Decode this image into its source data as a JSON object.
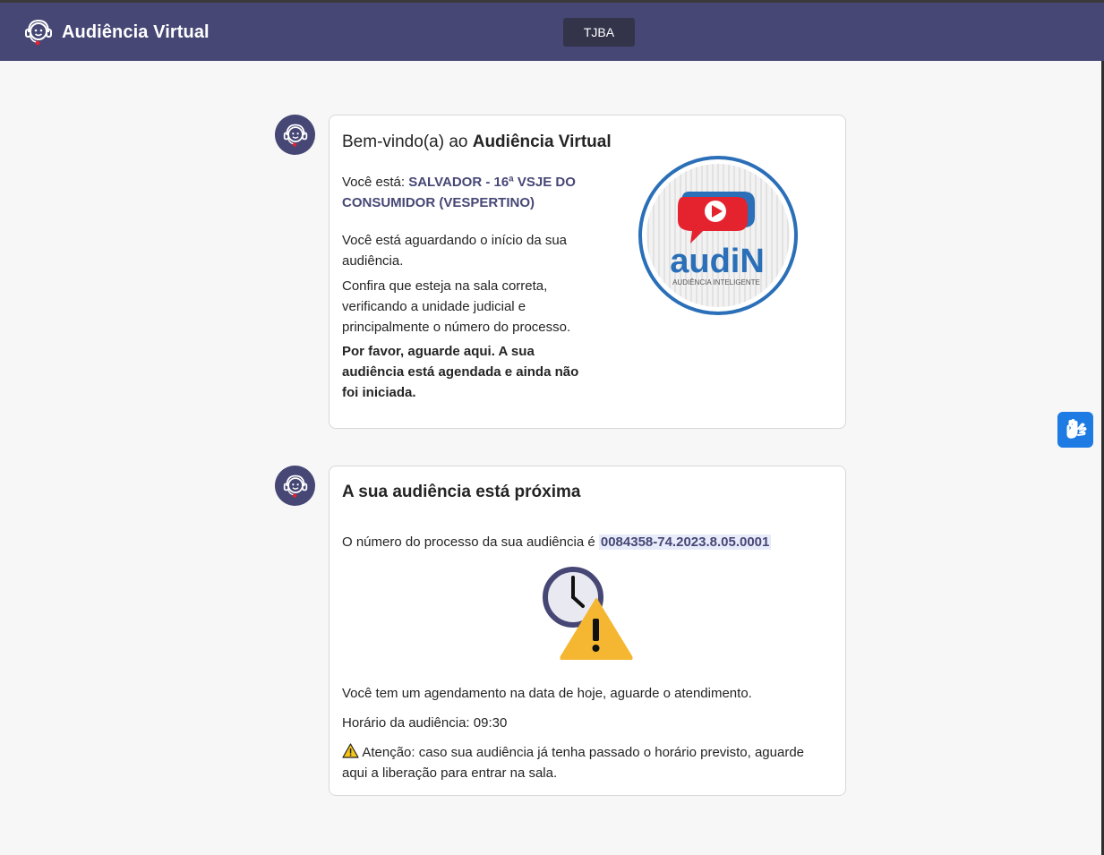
{
  "header": {
    "title": "Audiência Virtual",
    "tenant_label": "TJBA"
  },
  "welcome_card": {
    "greeting_prefix": "Bem-vindo(a) ao ",
    "greeting_app": "Audiência Virtual",
    "location_prefix": "Você está: ",
    "location_line1": "SALVADOR - 16ª VSJE DO",
    "location_line2": "CONSUMIDOR (VESPERTINO)",
    "waiting_line1": "Você está aguardando o início da sua",
    "waiting_line2": "audiência.",
    "confirm_line1": "Confira que esteja na sala correta,",
    "confirm_line2": "verificando a unidade judicial e",
    "confirm_line3": "principalmente o número do processo.",
    "notice_line1": "Por favor, aguarde aqui. A sua",
    "notice_line2": "audiência está agendada e ainda não",
    "notice_line3": "foi iniciada.",
    "logo_word": "audiN",
    "logo_caption": "AUDIÊNCIA INTELIGENTE"
  },
  "hearing_card": {
    "title": "A sua audiência está próxima",
    "process_prefix": "O número do processo da sua audiência é ",
    "process_number": "0084358-74.2023.8.05.0001",
    "schedule_text": "Você tem um agendamento na data de hoje, aguarde o atendimento.",
    "time_text": "Horário da audiência: 09:30",
    "warning_line1": "Atenção: caso sua audiência já tenha passado o horário previsto, aguarde",
    "warning_line2": "aqui a liberação para entrar na sala."
  },
  "colors": {
    "header_bg": "#464775",
    "accent_navy": "#464775",
    "libras_blue": "#1e7be3",
    "warning_yellow": "#f5b731",
    "logo_red": "#e5232e",
    "logo_blue": "#2a6fb8"
  },
  "icons": {
    "brand": "headset-agent-icon",
    "avatar": "headset-agent-icon",
    "clock_warning": "clock-warning-icon",
    "warning": "warning-triangle-icon",
    "libras": "sign-language-hands-icon"
  }
}
